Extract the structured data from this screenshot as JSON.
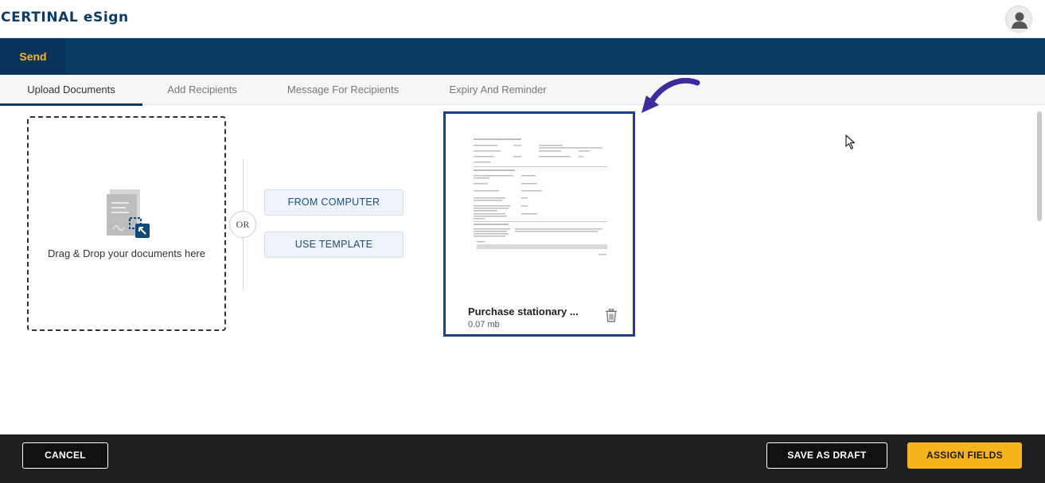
{
  "header": {
    "logo": "CERTINAL eSign",
    "avatar_icon": "user-avatar-icon"
  },
  "nav": {
    "send_label": "Send"
  },
  "tabs": [
    {
      "label": "Upload Documents",
      "active": true
    },
    {
      "label": "Add Recipients",
      "active": false
    },
    {
      "label": "Message For Recipients",
      "active": false
    },
    {
      "label": "Expiry And Reminder",
      "active": false
    }
  ],
  "upload": {
    "drop_text": "Drag & Drop your documents here",
    "or_label": "OR",
    "from_computer_label": "FROM COMPUTER",
    "use_template_label": "USE TEMPLATE"
  },
  "document": {
    "name": "Purchase stationary ...",
    "size": "0.07 mb"
  },
  "footer": {
    "cancel_label": "CANCEL",
    "save_draft_label": "SAVE AS DRAFT",
    "assign_fields_label": "ASSIGN FIELDS"
  },
  "colors": {
    "brand_navy": "#0b3b63",
    "accent_yellow": "#f5b31c",
    "card_border": "#1f3f8c",
    "annotation_arrow": "#3b2b9c"
  }
}
